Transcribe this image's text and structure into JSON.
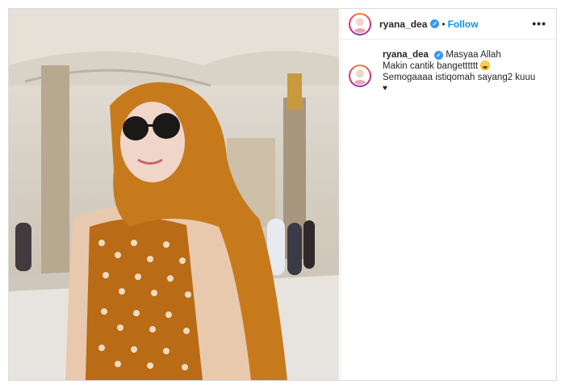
{
  "post": {
    "username": "ryana_dea",
    "verified_icon": "verified-badge-icon",
    "separator": "•",
    "follow_label": "Follow",
    "more_label": "•••"
  },
  "comment": {
    "username": "ryana_dea",
    "line1": "Masyaa Allah",
    "line2": "Makin cantik bangetttttt",
    "line3": "Semogaaaa istiqomah sayang2 kuuu",
    "line4": "♥"
  },
  "colors": {
    "accent_blue": "#0095f6",
    "verified_blue": "#3897f0",
    "text": "#262626",
    "border": "#dbdbdb",
    "hijab_orange": "#c77a1c"
  }
}
